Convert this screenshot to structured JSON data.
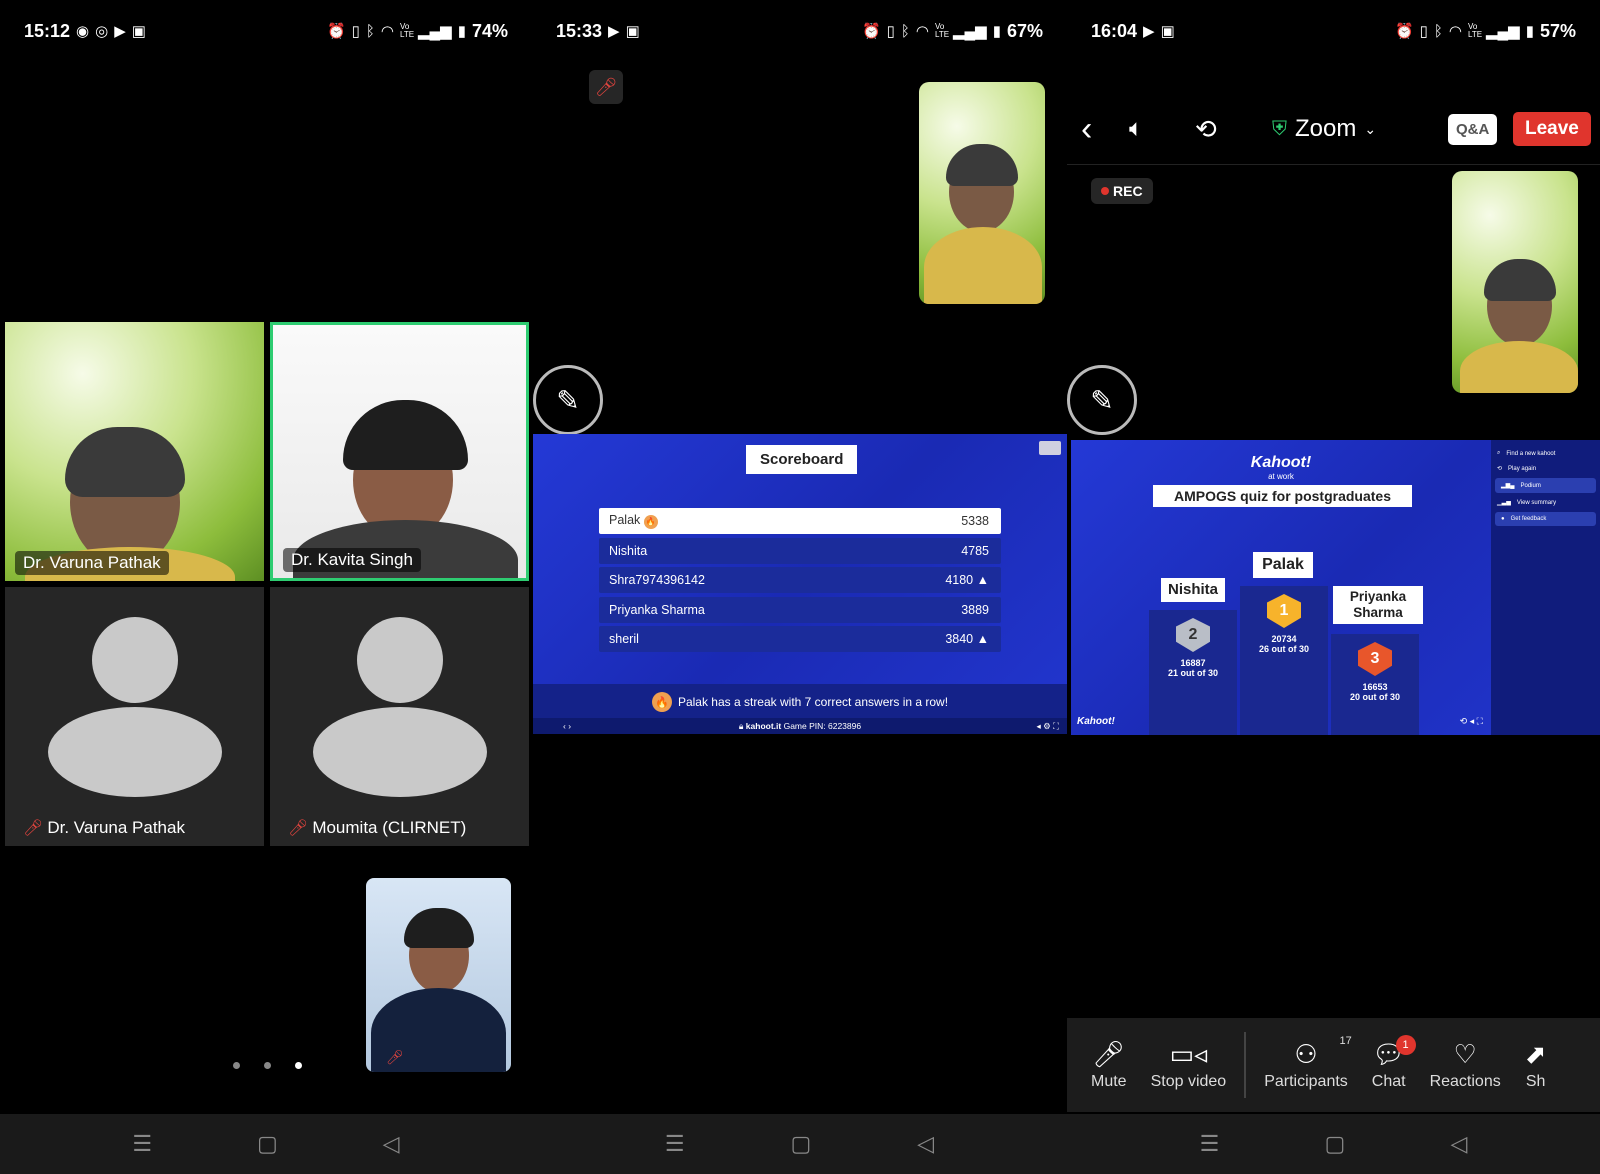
{
  "phone1": {
    "status": {
      "time": "15:12",
      "battery": "74%",
      "volte": "Vo LTE"
    },
    "tiles": [
      {
        "name": "Dr. Varuna Pathak"
      },
      {
        "name": "Dr. Kavita Singh"
      },
      {
        "name": "Dr. Varuna Pathak"
      },
      {
        "name": "Moumita (CLIRNET)"
      }
    ]
  },
  "phone2": {
    "status": {
      "time": "15:33",
      "battery": "67%",
      "volte": "Vo LTE"
    },
    "scoreboard": {
      "title": "Scoreboard",
      "rows": [
        {
          "name": "Palak",
          "score": "5338"
        },
        {
          "name": "Nishita",
          "score": "4785"
        },
        {
          "name": "Shra7974396142",
          "score": "4180"
        },
        {
          "name": "Priyanka Sharma",
          "score": "3889"
        },
        {
          "name": "sheril",
          "score": "3840"
        }
      ],
      "streak": "Palak has a streak with 7 correct answers in a row!",
      "footer_site": "kahoot.it",
      "footer_pin": "Game PIN: 6223896"
    }
  },
  "phone3": {
    "status": {
      "time": "16:04",
      "battery": "57%",
      "volte": "Vo LTE"
    },
    "header": {
      "title": "Zoom",
      "qa": "Q&A",
      "leave": "Leave"
    },
    "rec": "REC",
    "kahoot": {
      "logo": "Kahoot!",
      "logo_sub": "at work",
      "quiz_title": "AMPOGS quiz for postgraduates",
      "bottom_logo": "Kahoot!",
      "podium": [
        {
          "place": "2",
          "name": "Nishita",
          "score": "16887",
          "detail": "21 out of 30"
        },
        {
          "place": "1",
          "name": "Palak",
          "score": "20734",
          "detail": "26 out of 30"
        },
        {
          "place": "3",
          "name": "Priyanka Sharma",
          "score": "16653",
          "detail": "20 out of 30"
        }
      ],
      "side_items": [
        "Find a new kahoot",
        "Play again",
        "Podium",
        "View summary",
        "Get feedback"
      ]
    },
    "toolbar": {
      "mute": "Mute",
      "stop_video": "Stop video",
      "participants": "Participants",
      "participants_count": "17",
      "chat": "Chat",
      "chat_badge": "1",
      "reactions": "Reactions",
      "share": "Sh"
    }
  },
  "colors": {
    "accent_green": "#2ecc71",
    "leave_red": "#e0352d",
    "kahoot_blue": "#1d2fc8"
  }
}
